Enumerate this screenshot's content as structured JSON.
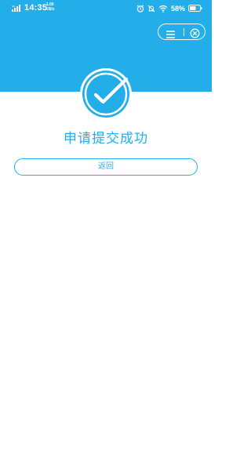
{
  "status_bar": {
    "time": "14:35",
    "net_speed_value": "1.00",
    "net_speed_unit": "KB/s",
    "battery_percent": "58%",
    "icons": [
      "signal-icon",
      "alarm-icon",
      "do-not-disturb-icon",
      "wifi-icon",
      "battery-icon"
    ]
  },
  "capsule": {
    "icons": [
      "menu-icon",
      "close-icon"
    ]
  },
  "result": {
    "title": "申请提交成功",
    "icon": "check-circle-icon"
  },
  "actions": {
    "back_label": "返回"
  },
  "colors": {
    "accent": "#23aee9",
    "background": "#ffffff",
    "on_accent": "#ffffff"
  }
}
